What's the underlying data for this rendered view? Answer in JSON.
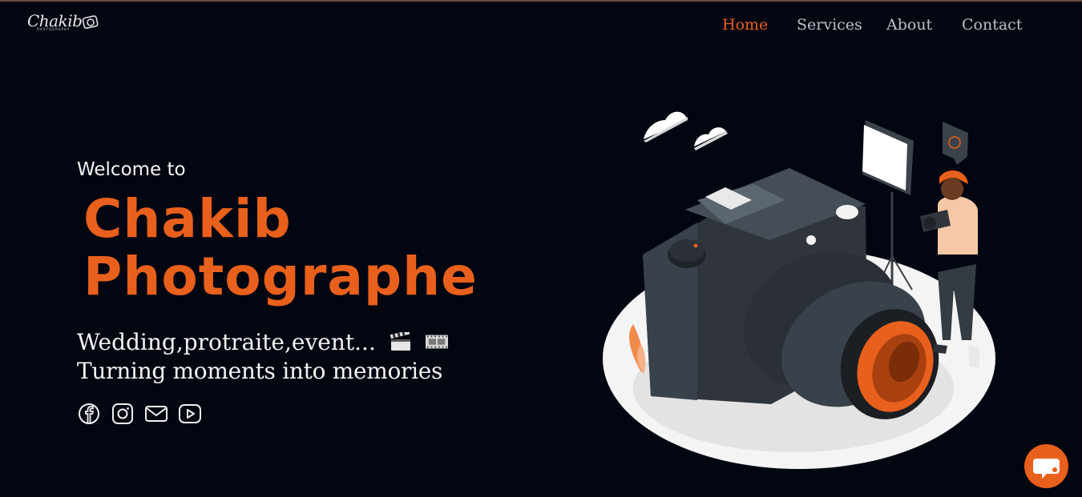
{
  "brand": {
    "logo_text": "Chakib",
    "logo_tagline": "PHOTOGRAPHY",
    "logo_icon": "camera-icon"
  },
  "nav": {
    "items": [
      {
        "label": "Home",
        "active": true
      },
      {
        "label": "Services",
        "active": false
      },
      {
        "label": "About",
        "active": false
      },
      {
        "label": "Contact",
        "active": false
      }
    ]
  },
  "hero": {
    "welcome": "Welcome to",
    "name_line1": "Chakib",
    "name_line2": "Photographe",
    "tagline_line1": "Wedding,protraite,event...",
    "tagline_line2": "Turning moments into memories",
    "tagline_icons": [
      "clapperboard-icon",
      "film-strip-icon"
    ]
  },
  "socials": [
    {
      "name": "facebook-icon"
    },
    {
      "name": "instagram-icon"
    },
    {
      "name": "mail-icon"
    },
    {
      "name": "youtube-icon"
    }
  ],
  "chat": {
    "icon": "chat-bubble-icon"
  },
  "colors": {
    "background": "#020611",
    "accent": "#e8601c",
    "nav_text": "#b9c0cc",
    "text": "#f4f4f4"
  }
}
